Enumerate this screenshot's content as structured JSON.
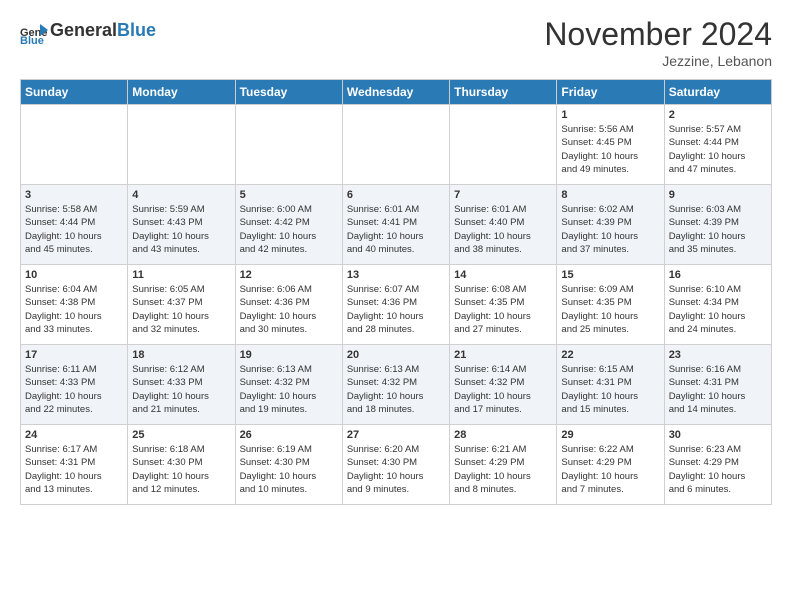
{
  "logo": {
    "general": "General",
    "blue": "Blue"
  },
  "title": "November 2024",
  "location": "Jezzine, Lebanon",
  "days_header": [
    "Sunday",
    "Monday",
    "Tuesday",
    "Wednesday",
    "Thursday",
    "Friday",
    "Saturday"
  ],
  "weeks": [
    [
      {
        "day": "",
        "info": ""
      },
      {
        "day": "",
        "info": ""
      },
      {
        "day": "",
        "info": ""
      },
      {
        "day": "",
        "info": ""
      },
      {
        "day": "",
        "info": ""
      },
      {
        "day": "1",
        "info": "Sunrise: 5:56 AM\nSunset: 4:45 PM\nDaylight: 10 hours\nand 49 minutes."
      },
      {
        "day": "2",
        "info": "Sunrise: 5:57 AM\nSunset: 4:44 PM\nDaylight: 10 hours\nand 47 minutes."
      }
    ],
    [
      {
        "day": "3",
        "info": "Sunrise: 5:58 AM\nSunset: 4:44 PM\nDaylight: 10 hours\nand 45 minutes."
      },
      {
        "day": "4",
        "info": "Sunrise: 5:59 AM\nSunset: 4:43 PM\nDaylight: 10 hours\nand 43 minutes."
      },
      {
        "day": "5",
        "info": "Sunrise: 6:00 AM\nSunset: 4:42 PM\nDaylight: 10 hours\nand 42 minutes."
      },
      {
        "day": "6",
        "info": "Sunrise: 6:01 AM\nSunset: 4:41 PM\nDaylight: 10 hours\nand 40 minutes."
      },
      {
        "day": "7",
        "info": "Sunrise: 6:01 AM\nSunset: 4:40 PM\nDaylight: 10 hours\nand 38 minutes."
      },
      {
        "day": "8",
        "info": "Sunrise: 6:02 AM\nSunset: 4:39 PM\nDaylight: 10 hours\nand 37 minutes."
      },
      {
        "day": "9",
        "info": "Sunrise: 6:03 AM\nSunset: 4:39 PM\nDaylight: 10 hours\nand 35 minutes."
      }
    ],
    [
      {
        "day": "10",
        "info": "Sunrise: 6:04 AM\nSunset: 4:38 PM\nDaylight: 10 hours\nand 33 minutes."
      },
      {
        "day": "11",
        "info": "Sunrise: 6:05 AM\nSunset: 4:37 PM\nDaylight: 10 hours\nand 32 minutes."
      },
      {
        "day": "12",
        "info": "Sunrise: 6:06 AM\nSunset: 4:36 PM\nDaylight: 10 hours\nand 30 minutes."
      },
      {
        "day": "13",
        "info": "Sunrise: 6:07 AM\nSunset: 4:36 PM\nDaylight: 10 hours\nand 28 minutes."
      },
      {
        "day": "14",
        "info": "Sunrise: 6:08 AM\nSunset: 4:35 PM\nDaylight: 10 hours\nand 27 minutes."
      },
      {
        "day": "15",
        "info": "Sunrise: 6:09 AM\nSunset: 4:35 PM\nDaylight: 10 hours\nand 25 minutes."
      },
      {
        "day": "16",
        "info": "Sunrise: 6:10 AM\nSunset: 4:34 PM\nDaylight: 10 hours\nand 24 minutes."
      }
    ],
    [
      {
        "day": "17",
        "info": "Sunrise: 6:11 AM\nSunset: 4:33 PM\nDaylight: 10 hours\nand 22 minutes."
      },
      {
        "day": "18",
        "info": "Sunrise: 6:12 AM\nSunset: 4:33 PM\nDaylight: 10 hours\nand 21 minutes."
      },
      {
        "day": "19",
        "info": "Sunrise: 6:13 AM\nSunset: 4:32 PM\nDaylight: 10 hours\nand 19 minutes."
      },
      {
        "day": "20",
        "info": "Sunrise: 6:13 AM\nSunset: 4:32 PM\nDaylight: 10 hours\nand 18 minutes."
      },
      {
        "day": "21",
        "info": "Sunrise: 6:14 AM\nSunset: 4:32 PM\nDaylight: 10 hours\nand 17 minutes."
      },
      {
        "day": "22",
        "info": "Sunrise: 6:15 AM\nSunset: 4:31 PM\nDaylight: 10 hours\nand 15 minutes."
      },
      {
        "day": "23",
        "info": "Sunrise: 6:16 AM\nSunset: 4:31 PM\nDaylight: 10 hours\nand 14 minutes."
      }
    ],
    [
      {
        "day": "24",
        "info": "Sunrise: 6:17 AM\nSunset: 4:31 PM\nDaylight: 10 hours\nand 13 minutes."
      },
      {
        "day": "25",
        "info": "Sunrise: 6:18 AM\nSunset: 4:30 PM\nDaylight: 10 hours\nand 12 minutes."
      },
      {
        "day": "26",
        "info": "Sunrise: 6:19 AM\nSunset: 4:30 PM\nDaylight: 10 hours\nand 10 minutes."
      },
      {
        "day": "27",
        "info": "Sunrise: 6:20 AM\nSunset: 4:30 PM\nDaylight: 10 hours\nand 9 minutes."
      },
      {
        "day": "28",
        "info": "Sunrise: 6:21 AM\nSunset: 4:29 PM\nDaylight: 10 hours\nand 8 minutes."
      },
      {
        "day": "29",
        "info": "Sunrise: 6:22 AM\nSunset: 4:29 PM\nDaylight: 10 hours\nand 7 minutes."
      },
      {
        "day": "30",
        "info": "Sunrise: 6:23 AM\nSunset: 4:29 PM\nDaylight: 10 hours\nand 6 minutes."
      }
    ]
  ]
}
